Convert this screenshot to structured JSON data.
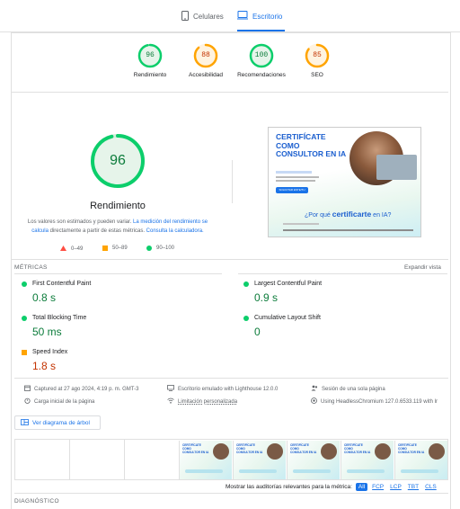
{
  "tabs": {
    "mobile": "Celulares",
    "desktop": "Escritorio"
  },
  "summary": [
    {
      "score": "96",
      "label": "Rendimiento",
      "color": "#0c9c4f"
    },
    {
      "score": "88",
      "label": "Accesibilidad",
      "color": "#f29900"
    },
    {
      "score": "100",
      "label": "Recomendaciones",
      "color": "#0c9c4f"
    },
    {
      "score": "85",
      "label": "SEO",
      "color": "#f29900"
    }
  ],
  "performance": {
    "score": "96",
    "title": "Rendimiento",
    "note_part1": "Los valores son estimados y pueden variar. ",
    "note_link1": "La medición del rendimiento se calcula",
    "note_part2": " directamente a partir de estas métricas. ",
    "note_link2": "Consulta la calculadora.",
    "legend": [
      "0–49",
      "50–89",
      "90–100"
    ]
  },
  "hero": {
    "title": "CERTIFÍCATE COMO CONSULTOR EN IA",
    "subtitle": "¿Por qué certificarte en IA?",
    "cta": "SOLICITAR ESTE/TU",
    "question": "¿Por qué",
    "question_strong": "certificarte",
    "question_end": "en IA?"
  },
  "metrics_section": {
    "title": "MÉTRICAS",
    "expand": "Expandir vista"
  },
  "metrics": [
    {
      "label": "First Contentful Paint",
      "value": "0.8 s",
      "status": "good"
    },
    {
      "label": "Largest Contentful Paint",
      "value": "0.9 s",
      "status": "good"
    },
    {
      "label": "Total Blocking Time",
      "value": "50 ms",
      "status": "good"
    },
    {
      "label": "Cumulative Layout Shift",
      "value": "0",
      "status": "good"
    },
    {
      "label": "Speed Index",
      "value": "1.8 s",
      "status": "average"
    }
  ],
  "run_info": {
    "captured": "Captured at 27 ago 2024, 4:19 p. m. GMT-3",
    "emulated": "Escritorio emulado with Lighthouse 12.0.0",
    "session": "Sesión de una sola página",
    "initial_load": "Carga inicial de la página",
    "throttling": "Limitación personalizada",
    "browser": "Using HeadlessChromium 127.0.6533.119 with lr"
  },
  "treemap_button": "Ver diagrama de árbol",
  "filmstrip": {
    "thumb_title": "CERTIFÍCATE COMO CONSULTOR EN IA",
    "thumb_sub": "¿Por qué certificarte en IA?"
  },
  "audit_filter": {
    "label": "Mostrar las auditorías relevantes para la métrica:",
    "options": [
      "All",
      "FCP",
      "LCP",
      "TBT",
      "CLS"
    ]
  },
  "diagnostics_title": "DIAGNÓSTICO"
}
